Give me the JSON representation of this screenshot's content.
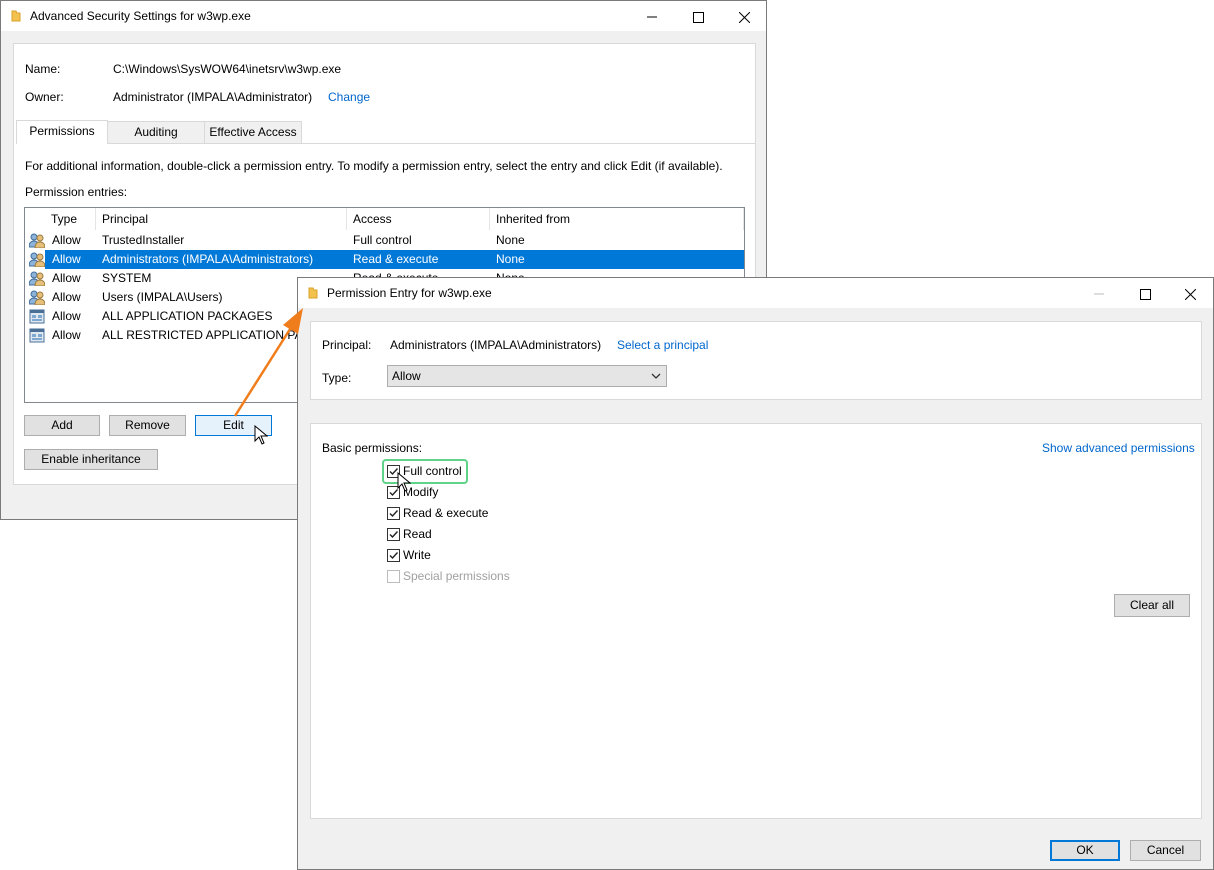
{
  "adv": {
    "title": "Advanced Security Settings for w3wp.exe",
    "name_label": "Name:",
    "name_value": "C:\\Windows\\SysWOW64\\inetsrv\\w3wp.exe",
    "owner_label": "Owner:",
    "owner_value": "Administrator (IMPALA\\Administrator)",
    "owner_change": "Change",
    "tabs": [
      "Permissions",
      "Auditing",
      "Effective Access"
    ],
    "info_text": "For additional information, double-click a permission entry. To modify a permission entry, select the entry and click Edit (if available).",
    "entries_label": "Permission entries:",
    "columns": [
      "Type",
      "Principal",
      "Access",
      "Inherited from"
    ],
    "rows": [
      {
        "type": "Allow",
        "principal": "TrustedInstaller",
        "access": "Full control",
        "inherited": "None",
        "icon": "users-icon"
      },
      {
        "type": "Allow",
        "principal": "Administrators (IMPALA\\Administrators)",
        "access": "Read & execute",
        "inherited": "None",
        "icon": "users-icon",
        "selected": true
      },
      {
        "type": "Allow",
        "principal": "SYSTEM",
        "access": "Read & execute",
        "inherited": "None",
        "icon": "users-icon"
      },
      {
        "type": "Allow",
        "principal": "Users (IMPALA\\Users)",
        "access": "",
        "inherited": "",
        "icon": "users-icon"
      },
      {
        "type": "Allow",
        "principal": "ALL APPLICATION PACKAGES",
        "access": "",
        "inherited": "",
        "icon": "app-package-icon"
      },
      {
        "type": "Allow",
        "principal": "ALL RESTRICTED APPLICATION PAC",
        "access": "",
        "inherited": "",
        "icon": "app-package-icon"
      }
    ],
    "buttons": {
      "add": "Add",
      "remove": "Remove",
      "edit": "Edit",
      "enable_inheritance": "Enable inheritance"
    }
  },
  "entry": {
    "title": "Permission Entry for w3wp.exe",
    "principal_label": "Principal:",
    "principal_value": "Administrators (IMPALA\\Administrators)",
    "select_principal": "Select a principal",
    "type_label": "Type:",
    "type_value": "Allow",
    "basic_label": "Basic permissions:",
    "show_advanced": "Show advanced permissions",
    "permissions": [
      {
        "label": "Full control",
        "checked": true,
        "disabled": false
      },
      {
        "label": "Modify",
        "checked": true,
        "disabled": false
      },
      {
        "label": "Read & execute",
        "checked": true,
        "disabled": false
      },
      {
        "label": "Read",
        "checked": true,
        "disabled": false
      },
      {
        "label": "Write",
        "checked": true,
        "disabled": false
      },
      {
        "label": "Special permissions",
        "checked": false,
        "disabled": true
      }
    ],
    "clear_all": "Clear all",
    "ok": "OK",
    "cancel": "Cancel"
  },
  "colors": {
    "accent": "#0078d7",
    "link": "#0066cc",
    "highlight": "#5fd38a",
    "callout_arrow": "#f07d1c"
  }
}
